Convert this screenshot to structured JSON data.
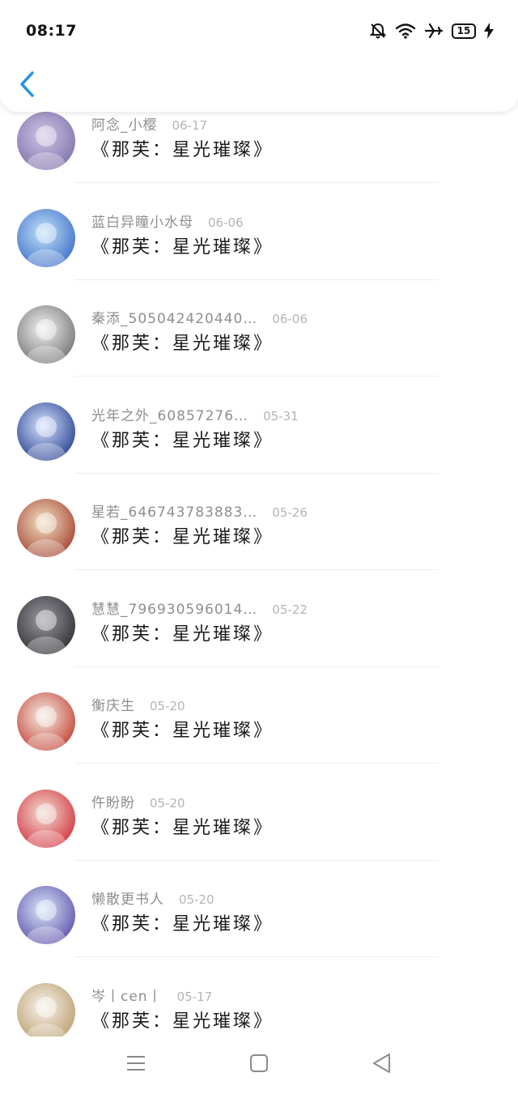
{
  "status_bar": {
    "time": "08:17",
    "battery_level": "15",
    "icons": [
      "bell-off-icon",
      "wifi-icon",
      "airplane-icon",
      "battery-icon",
      "charging-bolt-icon"
    ]
  },
  "header": {
    "back_icon": "chevron-left-icon",
    "accent_color": "#2a94e6"
  },
  "comments": [
    {
      "name": "阿念_小樱",
      "date": "06-17",
      "text": "《那芙：星光璀璨》",
      "avatar_colors": [
        "#7b6fa8",
        "#cfc4e6"
      ]
    },
    {
      "name": "蓝白异瞳小水母",
      "date": "06-06",
      "text": "《那芙：星光璀璨》",
      "avatar_colors": [
        "#3a68c8",
        "#bfe2f7"
      ]
    },
    {
      "name": "秦添_505042420440…",
      "date": "06-06",
      "text": "《那芙：星光璀璨》",
      "avatar_colors": [
        "#6d6d6d",
        "#f2f2f2"
      ]
    },
    {
      "name": "光年之外_60857276…",
      "date": "05-31",
      "text": "《那芙：星光璀璨》",
      "avatar_colors": [
        "#1e3a8a",
        "#d6e2ff"
      ]
    },
    {
      "name": "星若_646743783883…",
      "date": "05-26",
      "text": "《那芙：星光璀璨》",
      "avatar_colors": [
        "#a23a2a",
        "#f3e3c4"
      ]
    },
    {
      "name": "慧慧_796930596014…",
      "date": "05-22",
      "text": "《那芙：星光璀璨》",
      "avatar_colors": [
        "#2a2a2e",
        "#9a9aa2"
      ]
    },
    {
      "name": "衡庆生",
      "date": "05-20",
      "text": "《那芙：星光璀璨》",
      "avatar_colors": [
        "#c1392b",
        "#f5efe6"
      ]
    },
    {
      "name": "仵盼盼",
      "date": "05-20",
      "text": "《那芙：星光璀璨》",
      "avatar_colors": [
        "#d42a3a",
        "#efe0d0"
      ]
    },
    {
      "name": "懒散更书人",
      "date": "05-20",
      "text": "《那芙：星光璀璨》",
      "avatar_colors": [
        "#5a4aa8",
        "#d8e8f8"
      ]
    },
    {
      "name": "岑丨cen丨",
      "date": "05-17",
      "text": "《那芙：星光璀璨》",
      "avatar_colors": [
        "#b89a6a",
        "#f7f2ea"
      ]
    }
  ],
  "nav_bar": {
    "icons": [
      "menu-icon",
      "home-square-icon",
      "back-triangle-icon"
    ]
  }
}
